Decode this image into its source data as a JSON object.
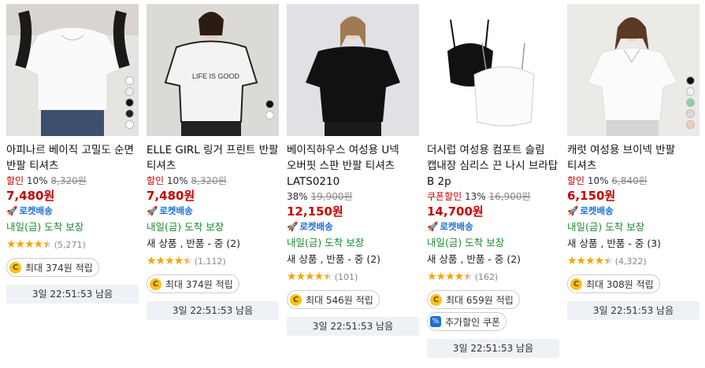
{
  "products": [
    {
      "title": "아피나르 베이직 고밀도 순면 반팔 티셔츠",
      "discount_label": "할인",
      "discount_pct": "10%",
      "orig_price": "8,320원",
      "price": "7,480원",
      "rocket_label": "로켓배송",
      "delivery": "내일(금) 도착 보장",
      "rating_count": "(5,271)",
      "rating": 4.5,
      "points": "최대 374원 적립",
      "timer": "3일 22:51:53 남음"
    },
    {
      "title": "ELLE GIRL 링거 프린트 반팔 티셔츠",
      "discount_label": "할인",
      "discount_pct": "10%",
      "orig_price": "8,320원",
      "price": "7,480원",
      "rocket_label": "로켓배송",
      "delivery": "내일(금) 도착 보장",
      "options": "새 상품 , 반품 - 중 (2)",
      "rating_count": "(1,112)",
      "rating": 4.5,
      "points": "최대 374원 적립",
      "timer": "3일 22:51:53 남음"
    },
    {
      "title": "베이직하우스 여성용 U넥 오버핏 스판 반팔 티셔츠 LATS0210",
      "discount_label": "",
      "discount_pct": "38%",
      "orig_price": "19,900원",
      "price": "12,150원",
      "rocket_label": "로켓배송",
      "delivery": "내일(금) 도착 보장",
      "options": "새 상품 , 반품 - 중 (2)",
      "rating_count": "(101)",
      "rating": 4.5,
      "points": "최대 546원 적립",
      "timer": "3일 22:51:53 남음"
    },
    {
      "title": "더시럽 여성용 컴포트 슬림 캡내장 심리스 끈 나시 브라탑 B 2p",
      "discount_label": "쿠폰할인",
      "discount_pct": "13%",
      "orig_price": "16,900원",
      "price": "14,700원",
      "rocket_label": "로켓배송",
      "delivery": "내일(금) 도착 보장",
      "options": "새 상품 , 반품 - 중 (2)",
      "rating_count": "(162)",
      "rating": 4.5,
      "points": "최대 659원 적립",
      "coupon": "추가할인 쿠폰",
      "timer": "3일 22:51:53 남음"
    },
    {
      "title": "캐럿 여성용 브이넥 반팔 티셔츠",
      "discount_label": "할인",
      "discount_pct": "10%",
      "orig_price": "6,840원",
      "price": "6,150원",
      "rocket_label": "로켓배송",
      "delivery": "내일(금) 도착 보장",
      "options": "새 상품 , 반품 - 중 (3)",
      "rating_count": "(4,322)",
      "rating": 4.5,
      "points": "최대 308원 적립",
      "timer": "3일 22:51:53 남음"
    }
  ],
  "colors": {
    "price": "#c80000",
    "rocket": "#1a6fd8",
    "delivery": "#1a8a2e",
    "star": "#f6a500"
  },
  "icons": {
    "rocket": "rocket-icon",
    "coin": "coin-icon",
    "coupon": "coupon-icon",
    "star": "star-icon"
  },
  "coin_glyph": "C",
  "coupon_glyph": "%"
}
